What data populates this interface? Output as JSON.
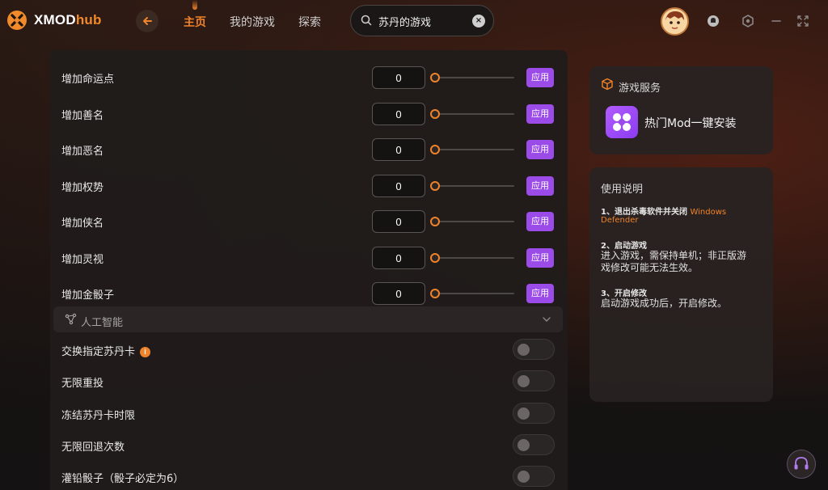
{
  "app": {
    "brand_x": "XMOD",
    "brand_hub": "hub"
  },
  "nav": {
    "home": "主页",
    "my_games": "我的游戏",
    "explore": "探索"
  },
  "search": {
    "value": "苏丹的游戏",
    "clear_icon": "×"
  },
  "numeric_rows": [
    {
      "label": "增加命运点",
      "value": "0",
      "button": "应用"
    },
    {
      "label": "增加善名",
      "value": "0",
      "button": "应用"
    },
    {
      "label": "增加恶名",
      "value": "0",
      "button": "应用"
    },
    {
      "label": "增加权势",
      "value": "0",
      "button": "应用"
    },
    {
      "label": "增加侠名",
      "value": "0",
      "button": "应用"
    },
    {
      "label": "增加灵视",
      "value": "0",
      "button": "应用"
    },
    {
      "label": "增加金骰子",
      "value": "0",
      "button": "应用"
    }
  ],
  "ai_section": {
    "title": "人工智能"
  },
  "toggle_rows": [
    {
      "label": "交换指定苏丹卡",
      "info": "i",
      "on": false
    },
    {
      "label": "无限重投",
      "on": false
    },
    {
      "label": "冻结苏丹卡时限",
      "on": false
    },
    {
      "label": "无限回退次数",
      "on": false
    },
    {
      "label": "灌铅骰子（骰子必定为6）",
      "on": false
    }
  ],
  "game_service": {
    "title": "游戏服务",
    "mod_install": "热门Mod一键安装"
  },
  "instructions": {
    "title": "使用说明",
    "step1_title": "1、退出杀毒软件并关闭",
    "step1_highlight_a": "Windows",
    "step1_highlight_b": "Defender",
    "step2_title": "2、启动游戏",
    "step2_body_1": "进入游戏，需保持单机；非正版游",
    "step2_body_2": "戏修改可能无法生效。",
    "step3_title": "3、开启修改",
    "step3_body": "启动游戏成功后，开启修改。"
  },
  "colors": {
    "accent_orange": "#f0832a",
    "accent_purple": "#9b4be8"
  }
}
